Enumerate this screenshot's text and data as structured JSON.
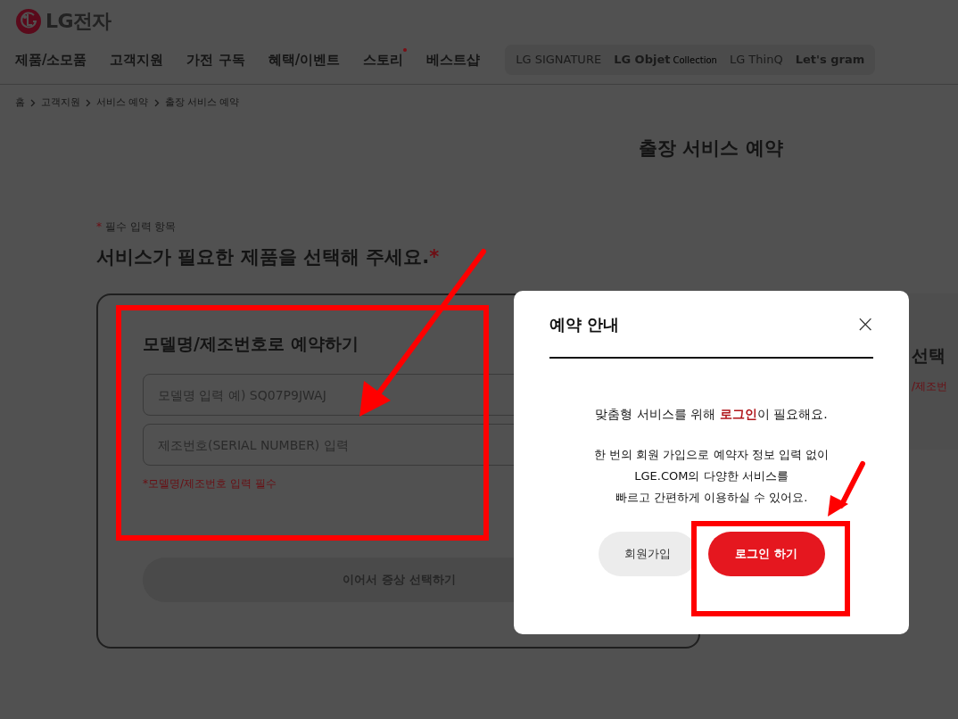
{
  "header": {
    "logo": "LG전자",
    "nav": [
      {
        "label": "제품/소모품",
        "new_dot": false
      },
      {
        "label": "고객지원",
        "new_dot": false
      },
      {
        "label": "가전 구독",
        "new_dot": false
      },
      {
        "label": "혜택/이벤트",
        "new_dot": false
      },
      {
        "label": "스토리",
        "new_dot": true
      },
      {
        "label": "베스트샵",
        "new_dot": false
      }
    ],
    "brands": [
      "LG SIGNATURE",
      "LG Objet",
      "Collection",
      "LG ThinQ",
      "Let's gram"
    ]
  },
  "breadcrumb": [
    "홈",
    "고객지원",
    "서비스 예약",
    "출장 서비스 예약"
  ],
  "page_title": "출장 서비스 예약",
  "required_note": {
    "mark": "*",
    "text": "필수 입력 항목"
  },
  "section_title": {
    "text": "서비스가 필요한 제품을 선택해 주세요.",
    "mark": "*"
  },
  "card": {
    "title": "모델명/제조번호로 예약하기",
    "fields": [
      {
        "placeholder": "모델명 입력 예) SQ07P9JWAJ"
      },
      {
        "placeholder": "제조번호(SERIAL NUMBER) 입력"
      }
    ],
    "hint": "*모델명/제조번호 입력 필수",
    "button": "이어서 증상 선택하기"
  },
  "side_card": {
    "title": "선택",
    "hint": "/제조번"
  },
  "modal": {
    "title": "예약 안내",
    "close": "×",
    "message": "맞춤형 서비스를 위해 **로그인**이 필요해요.",
    "details": [
      "한 번의 회원 가입으로 예약자 정보 입력 없이",
      "LGE.COM의 다양한 서비스를",
      "빠르고 간편하게 이용하실 수 있어요."
    ],
    "buttons": [
      {
        "label": "회원가입",
        "kind": "secondary"
      },
      {
        "label": "로그인 하기",
        "kind": "primary"
      }
    ]
  }
}
